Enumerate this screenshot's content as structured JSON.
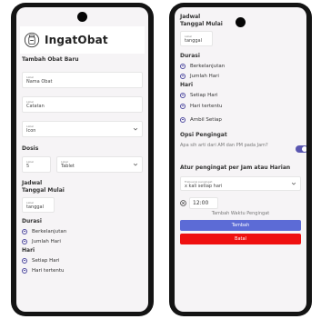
{
  "left_screen": {
    "app_title": "IngatObat",
    "add_medicine_title": "Tambah Obat Baru",
    "name_field": {
      "label": "Label",
      "value": "Nama Obat"
    },
    "note_field": {
      "label": "Label",
      "value": "Catatan"
    },
    "icon_field": {
      "label": "Label",
      "value": "Icon"
    },
    "dose_title": "Dosis",
    "dose_amount_field": {
      "label": "Label",
      "value": "5"
    },
    "dose_unit_field": {
      "label": "Label",
      "value": "Tablet"
    },
    "schedule_title": "Jadwal",
    "start_date_title": "Tanggal Mulai",
    "start_date_field": {
      "label": "Label",
      "value": "tanggal"
    },
    "duration_title": "Durasi",
    "duration_options": [
      "Berkelanjutan",
      "Jumlah Hari"
    ],
    "days_title": "Hari",
    "days_options": [
      "Setiap Hari",
      "Hari tertentu"
    ]
  },
  "right_screen": {
    "schedule_title": "Jadwal",
    "start_date_title": "Tanggal Mulai",
    "start_date_field": {
      "label": "Label",
      "value": "tanggal"
    },
    "duration_title": "Durasi",
    "duration_options": [
      "Berkelanjutan",
      "Jumlah Hari"
    ],
    "days_title": "Hari",
    "days_options": [
      "Setiap Hari",
      "Hari tertentu",
      "Ambil Setiap"
    ],
    "reminder_title": "Opsi Pengingat",
    "am_pm_question": "Apa sih arti dari AM dan PM pada Jam?",
    "am_pm_toggle_on": true,
    "reminder_setting_title": "Atur pengingat per Jam atau Harian",
    "frequency_field": {
      "label": "Frekuensi pengingat",
      "value": "x kali setiap hari"
    },
    "reminder_time": "12:00",
    "add_reminder_time": "Tambah Waktu Pengingat",
    "add_button": "Tambah",
    "cancel_button": "Batal"
  },
  "colors": {
    "accent": "#4e4aa0",
    "primary_button": "#5c6bd6",
    "danger_button": "#ef1010",
    "screen_bg": "#f6f4f6"
  }
}
